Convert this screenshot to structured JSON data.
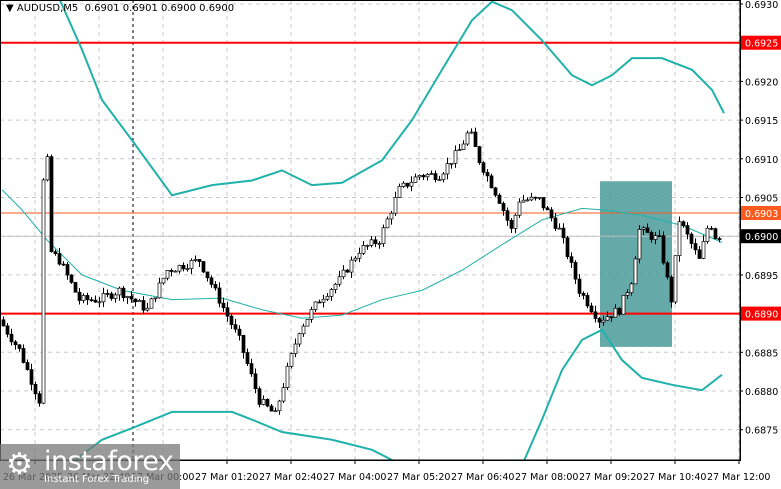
{
  "chart_data": {
    "type": "candlestick",
    "title": "AUDUSD,M5  0.6901 0.6901 0.6900 0.6900",
    "symbol": "AUDUSD,M5",
    "ohlc_last": "0.6901 0.6901 0.6900 0.6900",
    "ylim": [
      0.68715,
      0.69305
    ],
    "y_ticks": [
      "0.6930",
      "0.6925",
      "0.6920",
      "0.6915",
      "0.6910",
      "0.6905",
      "0.6900",
      "0.6895",
      "0.6890",
      "0.6885",
      "0.6880",
      "0.6875"
    ],
    "x_tick_labels": [
      "26 Mar 2025",
      "26 Mar 22:40",
      "27 Mar 00:00",
      "27 Mar 01:20",
      "27 Mar 02:40",
      "27 Mar 04:00",
      "27 Mar 05:20",
      "27 Mar 06:40",
      "27 Mar 08:00",
      "27 Mar 09:20",
      "27 Mar 10:40",
      "27 Mar 12:00"
    ],
    "bars_per_label": 16,
    "bar_count": 180,
    "close_path": [
      [
        0,
        0.68892
      ],
      [
        5,
        0.68853
      ],
      [
        10,
        0.68788
      ],
      [
        11.5,
        0.69212
      ],
      [
        12.5,
        0.68982
      ],
      [
        15,
        0.68969
      ],
      [
        20,
        0.68918
      ],
      [
        25,
        0.68918
      ],
      [
        30,
        0.6893
      ],
      [
        37,
        0.68905
      ],
      [
        42,
        0.68956
      ],
      [
        50,
        0.68969
      ],
      [
        55,
        0.68918
      ],
      [
        60,
        0.68866
      ],
      [
        65,
        0.68788
      ],
      [
        69,
        0.68769
      ],
      [
        72,
        0.68827
      ],
      [
        75,
        0.68879
      ],
      [
        80,
        0.68918
      ],
      [
        85,
        0.68943
      ],
      [
        90,
        0.68982
      ],
      [
        95,
        0.68995
      ],
      [
        100,
        0.6906
      ],
      [
        105,
        0.69079
      ],
      [
        110,
        0.69079
      ],
      [
        115,
        0.69111
      ],
      [
        117.5,
        0.69137
      ],
      [
        120,
        0.69098
      ],
      [
        125,
        0.69047
      ],
      [
        128,
        0.69008
      ],
      [
        130,
        0.69047
      ],
      [
        135,
        0.69047
      ],
      [
        140,
        0.69008
      ],
      [
        145,
        0.6893
      ],
      [
        150,
        0.68892
      ],
      [
        155,
        0.68905
      ],
      [
        158,
        0.68943
      ],
      [
        160,
        0.69008
      ],
      [
        165,
        0.68995
      ],
      [
        168,
        0.68918
      ],
      [
        170,
        0.69021
      ],
      [
        175,
        0.68969
      ],
      [
        177.5,
        0.69021
      ],
      [
        179,
        0.69
      ]
    ],
    "bollinger": {
      "color": "#20b2aa",
      "upper": [
        [
          12.5,
          0.69331
        ],
        [
          15,
          0.69299
        ],
        [
          20,
          0.69241
        ],
        [
          25,
          0.69176
        ],
        [
          32.5,
          0.69124
        ],
        [
          42.5,
          0.69053
        ],
        [
          52.5,
          0.69066
        ],
        [
          62.5,
          0.69072
        ],
        [
          70,
          0.69085
        ],
        [
          77.5,
          0.69066
        ],
        [
          85,
          0.69069
        ],
        [
          95,
          0.69098
        ],
        [
          102.5,
          0.6915
        ],
        [
          110,
          0.69215
        ],
        [
          117.5,
          0.69279
        ],
        [
          122.5,
          0.69303
        ],
        [
          127.5,
          0.69292
        ],
        [
          135,
          0.69253
        ],
        [
          142.5,
          0.69208
        ],
        [
          147.5,
          0.69195
        ],
        [
          152.5,
          0.69208
        ],
        [
          157.5,
          0.6923
        ],
        [
          165,
          0.6923
        ],
        [
          172.5,
          0.69215
        ],
        [
          177.5,
          0.69189
        ],
        [
          180.5,
          0.69159
        ]
      ],
      "middle": [
        [
          0,
          0.6906
        ],
        [
          5,
          0.69034
        ],
        [
          11.25,
          0.68995
        ],
        [
          20,
          0.6895
        ],
        [
          30,
          0.6893
        ],
        [
          42.5,
          0.68918
        ],
        [
          55,
          0.6892
        ],
        [
          65,
          0.68905
        ],
        [
          75,
          0.68894
        ],
        [
          85,
          0.68898
        ],
        [
          95,
          0.68918
        ],
        [
          105,
          0.6893
        ],
        [
          115,
          0.68956
        ],
        [
          125,
          0.68989
        ],
        [
          135,
          0.69021
        ],
        [
          145,
          0.69036
        ],
        [
          150,
          0.69034
        ],
        [
          160,
          0.69027
        ],
        [
          170,
          0.69014
        ],
        [
          180,
          0.68992
        ]
      ],
      "lower_a": [
        [
          15,
          0.68698
        ],
        [
          25,
          0.68737
        ],
        [
          32.5,
          0.68752
        ],
        [
          42.5,
          0.68773
        ],
        [
          57.5,
          0.68773
        ],
        [
          62.5,
          0.68763
        ],
        [
          70,
          0.68747
        ],
        [
          82.5,
          0.68737
        ],
        [
          92.5,
          0.68724
        ],
        [
          101.25,
          0.68701
        ]
      ],
      "lower_b": [
        [
          129.5,
          0.68698
        ],
        [
          135,
          0.68763
        ],
        [
          140,
          0.68827
        ],
        [
          145,
          0.68866
        ],
        [
          150,
          0.68879
        ],
        [
          155,
          0.6884
        ],
        [
          160,
          0.68817
        ],
        [
          167.5,
          0.68808
        ],
        [
          175,
          0.68801
        ],
        [
          180,
          0.68821
        ]
      ]
    },
    "levels": [
      {
        "price": 0.6925,
        "label": "0.6925",
        "color": "#ff0000",
        "style": "solid-thick"
      },
      {
        "price": 0.6903,
        "label": "0.6903",
        "color": "#ff5a1e",
        "style": "solid"
      },
      {
        "price": 0.689,
        "label": "0.6890",
        "color": "#ff0000",
        "style": "solid-thick"
      }
    ],
    "current_price": {
      "price": 0.69,
      "label": "0.6900",
      "color": "#000000"
    },
    "zone": {
      "bar_from": 149.5,
      "bar_to": 167.5,
      "price_top": 0.69071,
      "price_bottom": 0.68857,
      "color": "#4a9a9a"
    },
    "day_separator_bar": 32.75
  },
  "watermark": {
    "brand": "instaforex",
    "tagline": "Instant Forex Trading"
  }
}
